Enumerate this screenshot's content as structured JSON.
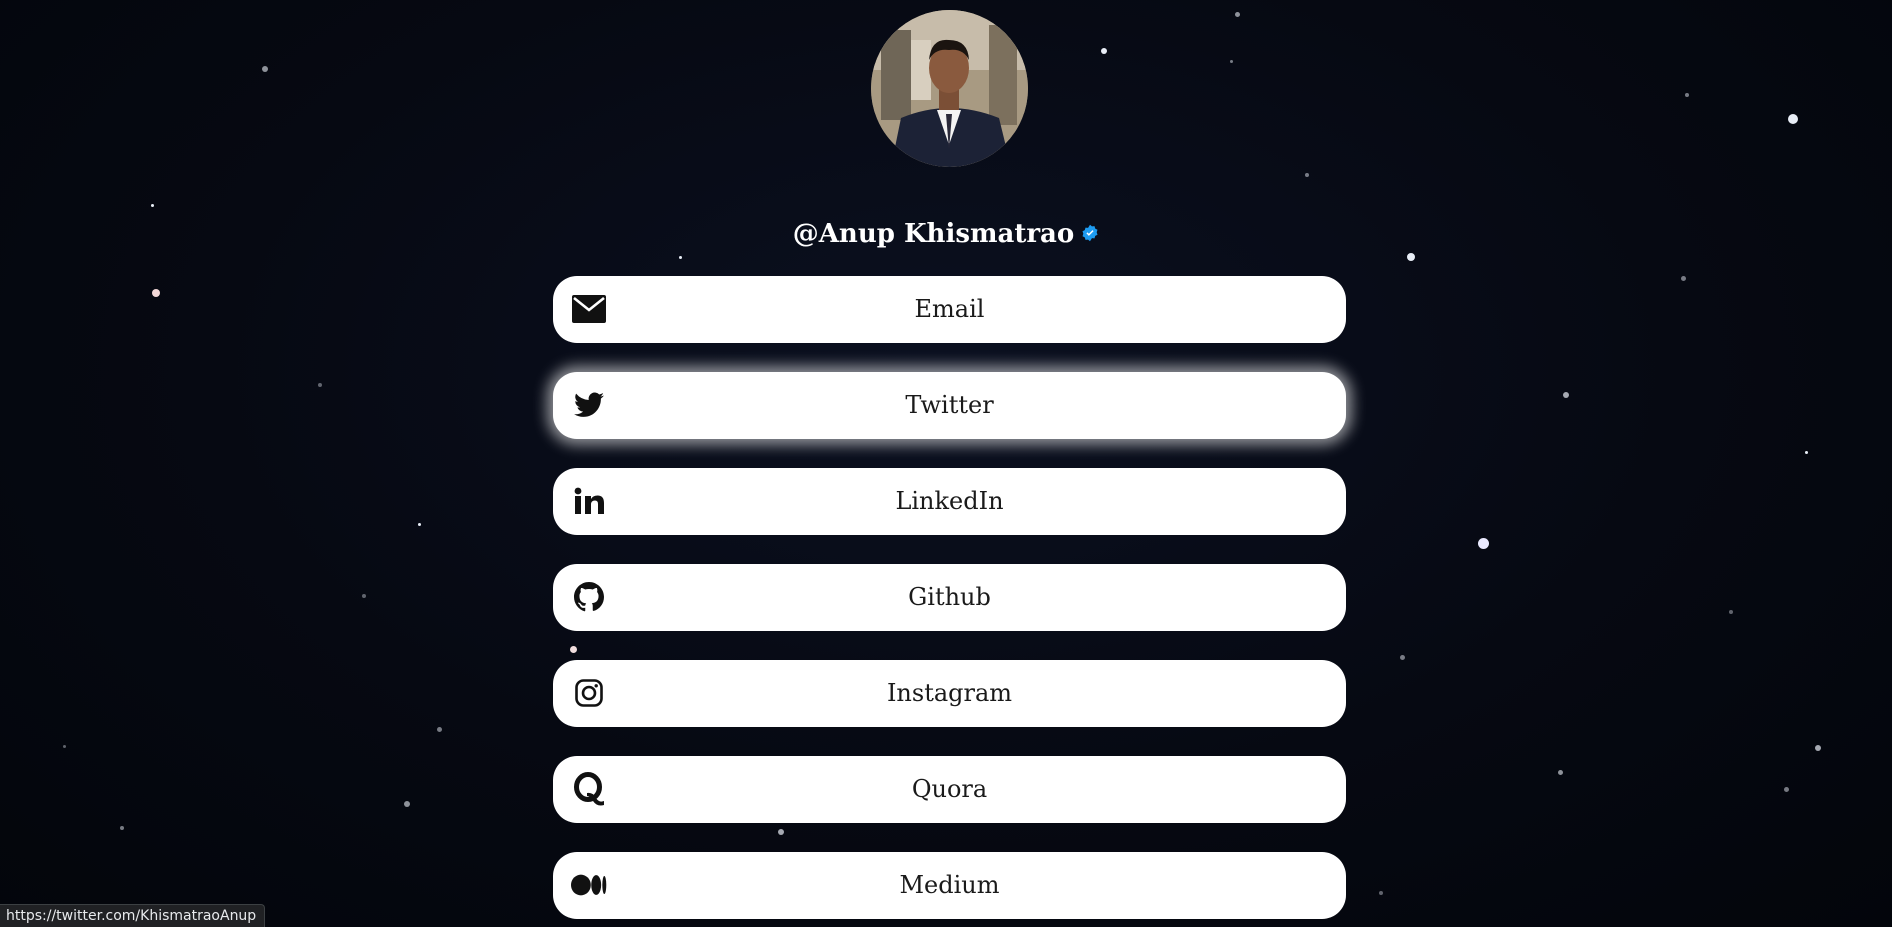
{
  "profile": {
    "handle": "@Anup Khismatrao",
    "verified": true
  },
  "links": [
    {
      "label": "Email",
      "icon": "envelope-icon"
    },
    {
      "label": "Twitter",
      "icon": "twitter-bird-icon"
    },
    {
      "label": "LinkedIn",
      "icon": "linkedin-icon"
    },
    {
      "label": "Github",
      "icon": "github-icon"
    },
    {
      "label": "Instagram",
      "icon": "instagram-icon"
    },
    {
      "label": "Quora",
      "icon": "quora-icon"
    },
    {
      "label": "Medium",
      "icon": "medium-icon"
    }
  ],
  "status_bar": {
    "url": "https://twitter.com/KhismatraoAnup"
  },
  "colors": {
    "background": "#050812",
    "button": "#ffffff",
    "verified": "#1d9bf0",
    "text": "#1a1a1a"
  }
}
